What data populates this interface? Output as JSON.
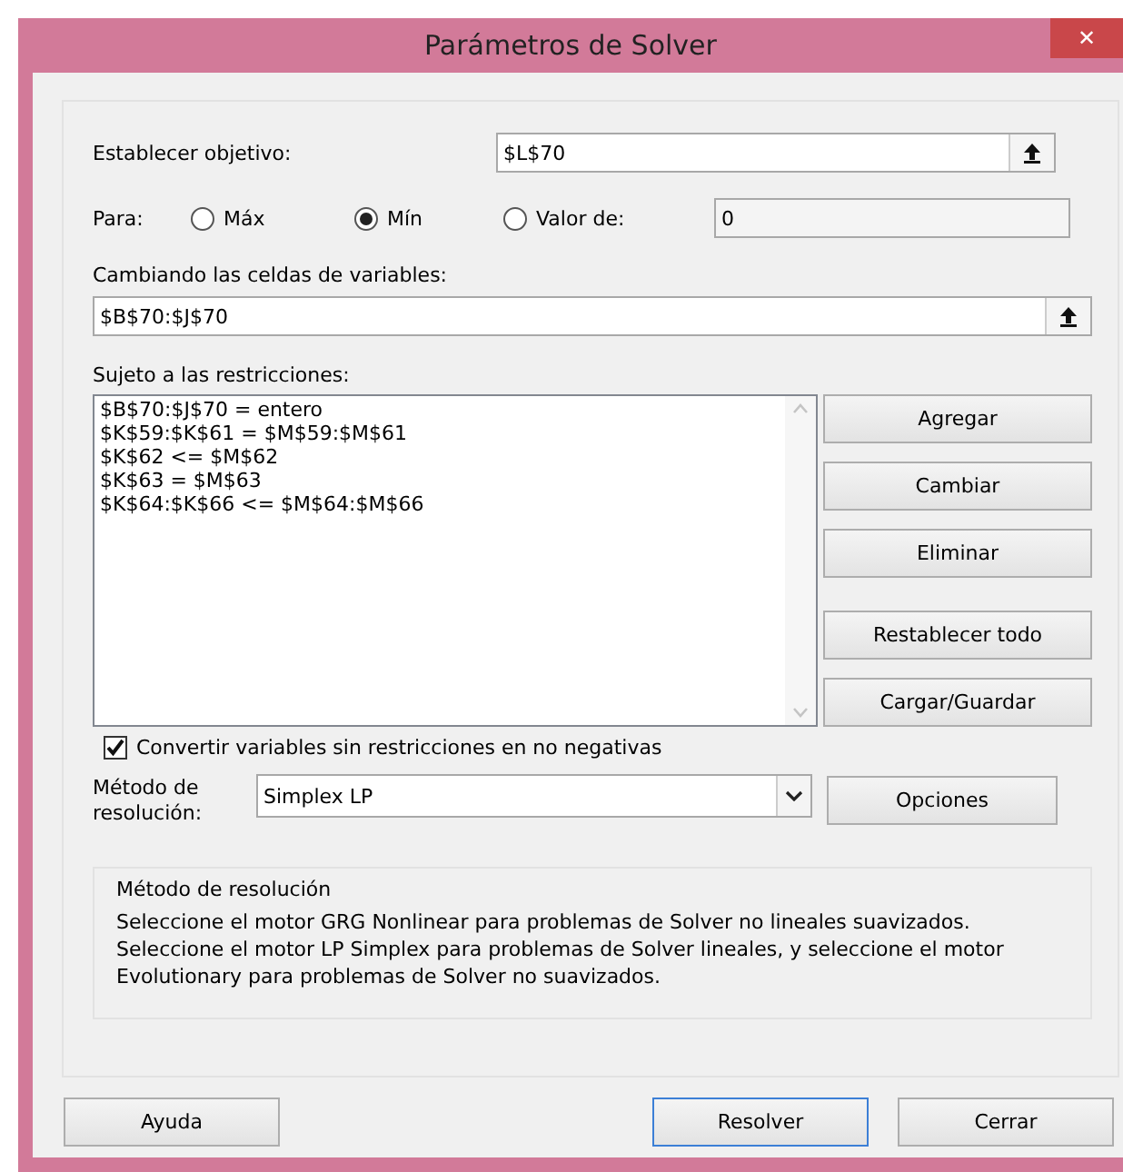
{
  "window": {
    "title": "Parámetros de Solver",
    "close": "✕"
  },
  "objective": {
    "label": "Establecer objetivo:",
    "value": "$L$70"
  },
  "to": {
    "label": "Para:",
    "options": [
      {
        "label": "Máx",
        "selected": false
      },
      {
        "label": "Mín",
        "selected": true
      },
      {
        "label": "Valor de:",
        "selected": false
      }
    ],
    "value": "0"
  },
  "variables": {
    "label": "Cambiando las celdas de variables:",
    "value": "$B$70:$J$70"
  },
  "constraints": {
    "label": "Sujeto a las restricciones:",
    "items": [
      "$B$70:$J$70 = entero",
      "$K$59:$K$61 = $M$59:$M$61",
      "$K$62 <= $M$62",
      "$K$63 = $M$63",
      "$K$64:$K$66 <= $M$64:$M$66"
    ]
  },
  "constraint_buttons": [
    {
      "label": "Agregar"
    },
    {
      "label": "Cambiar"
    },
    {
      "label": "Eliminar"
    },
    {
      "label": "Restablecer todo"
    },
    {
      "label": "Cargar/Guardar"
    }
  ],
  "nonnegative": {
    "label": "Convertir variables sin restricciones en no negativas",
    "checked": true
  },
  "method": {
    "label": "Método de resolución:",
    "value": "Simplex LP",
    "options_button": {
      "label": "Opciones"
    }
  },
  "description": {
    "title": "Método de resolución",
    "text": "Seleccione el motor GRG Nonlinear para problemas de Solver no lineales suavizados. Seleccione el motor LP Simplex para problemas de Solver lineales, y seleccione el motor Evolutionary para problemas de Solver no suavizados."
  },
  "buttons": [
    {
      "label": "Ayuda",
      "selected": false
    },
    {
      "label": "Resolver",
      "selected": true
    },
    {
      "label": "Cerrar",
      "selected": false
    }
  ]
}
